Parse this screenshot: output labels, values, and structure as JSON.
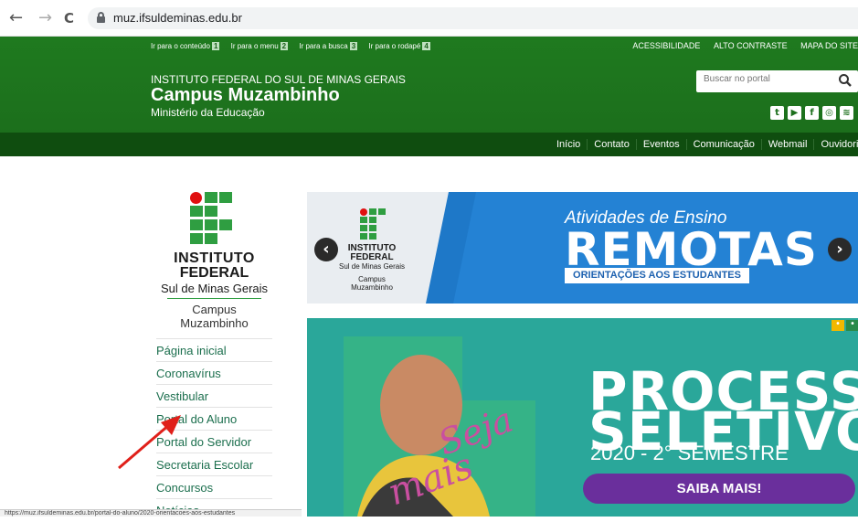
{
  "browser": {
    "back": "←",
    "forward": "→",
    "reload": "C",
    "url": "muz.ifsuldeminas.edu.br"
  },
  "skip_links": [
    {
      "label": "Ir para o conteúdo",
      "num": "1"
    },
    {
      "label": "Ir para o menu",
      "num": "2"
    },
    {
      "label": "Ir para a busca",
      "num": "3"
    },
    {
      "label": "Ir para o rodapé",
      "num": "4"
    }
  ],
  "top_links": [
    "ACESSIBILIDADE",
    "ALTO CONTRASTE",
    "MAPA DO SITE"
  ],
  "header": {
    "institute": "INSTITUTO FEDERAL DO SUL DE MINAS GERAIS",
    "campus": "Campus Muzambinho",
    "ministry": "Ministério da Educação"
  },
  "search": {
    "placeholder": "Buscar no portal"
  },
  "social_icons": [
    "twitter-icon",
    "youtube-icon",
    "facebook-icon",
    "instagram-icon",
    "rss-icon"
  ],
  "main_nav": [
    "Início",
    "Contato",
    "Eventos",
    "Comunicação",
    "Webmail",
    "Ouvidoria"
  ],
  "logo": {
    "line1": "INSTITUTO",
    "line2": "FEDERAL",
    "line3": "Sul de Minas Gerais",
    "line4": "Campus",
    "line5": "Muzambinho"
  },
  "side_menu": [
    "Página inicial",
    "Coronavírus",
    "Vestibular",
    "Portal do Aluno",
    "Portal do Servidor",
    "Secretaria Escolar",
    "Concursos",
    "Notícias"
  ],
  "banner1": {
    "title": "Atividades de Ensino",
    "big": "REMOTAS",
    "sub": "ORIENTAÇÕES AOS ESTUDANTES",
    "logo_l1": "INSTITUTO",
    "logo_l2": "FEDERAL",
    "logo_l3": "Sul de Minas Gerais",
    "logo_l4": "Campus",
    "logo_l5": "Muzambinho",
    "prev": "‹",
    "next": "›"
  },
  "banner2": {
    "line1": "PROCESSO",
    "line2": "SELETIVO",
    "line3": "2020 - 2° SEMESTRE",
    "button": "SAIBA MAIS!",
    "script1": "Seja",
    "script2": "mais"
  },
  "status_url": "https://muz.ifsuldeminas.edu.br/portal-do-aluno/2020-orientacoes-aos-estudantes"
}
